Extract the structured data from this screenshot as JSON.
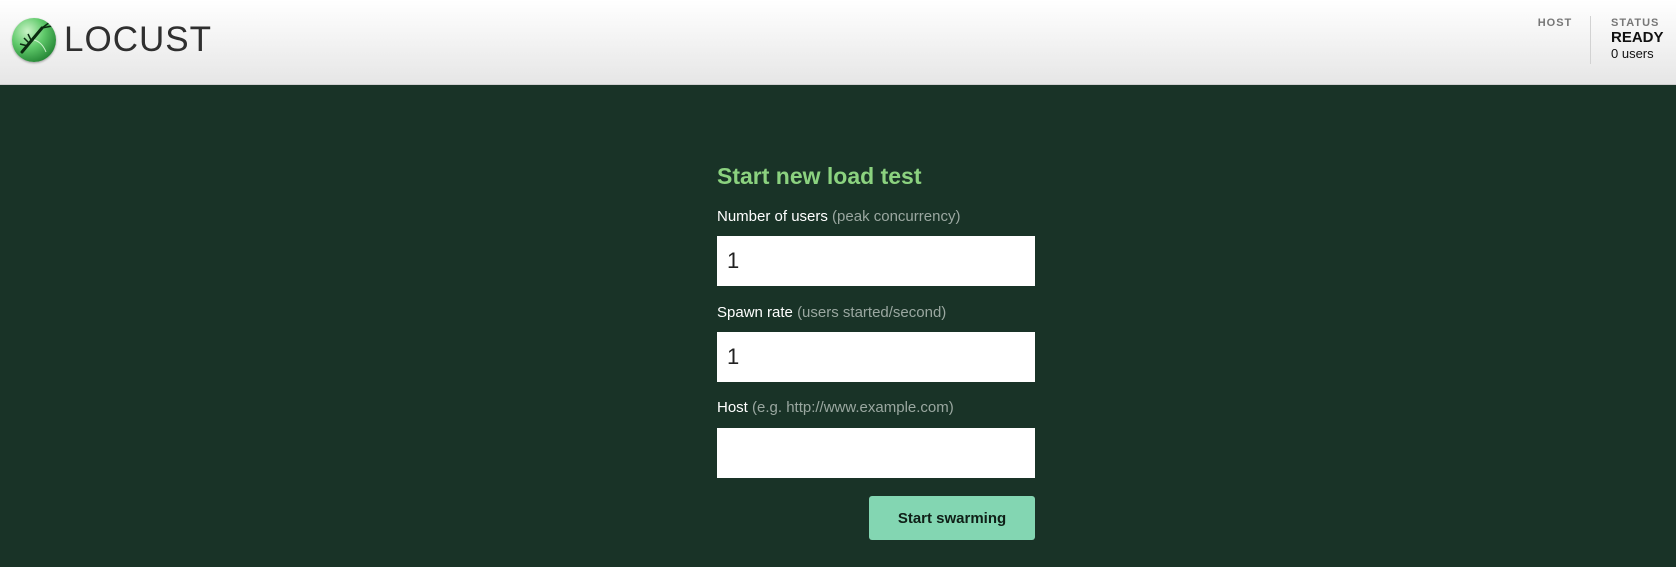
{
  "header": {
    "logo_text": "LOCUST",
    "logo_icon": "locust-logo-icon",
    "host": {
      "label": "HOST"
    },
    "status": {
      "label": "STATUS",
      "value": "READY",
      "users": "0 users"
    }
  },
  "form": {
    "title": "Start new load test",
    "fields": [
      {
        "label": "Number of users",
        "hint": "(peak concurrency)",
        "value": "1"
      },
      {
        "label": "Spawn rate",
        "hint": "(users started/second)",
        "value": "1"
      },
      {
        "label": "Host",
        "hint": "(e.g. http://www.example.com)",
        "value": ""
      }
    ],
    "submit_label": "Start swarming"
  },
  "colors": {
    "background": "#193327",
    "title": "#8bd27f",
    "button": "#83d6b2",
    "hint": "#9aa7a0"
  }
}
